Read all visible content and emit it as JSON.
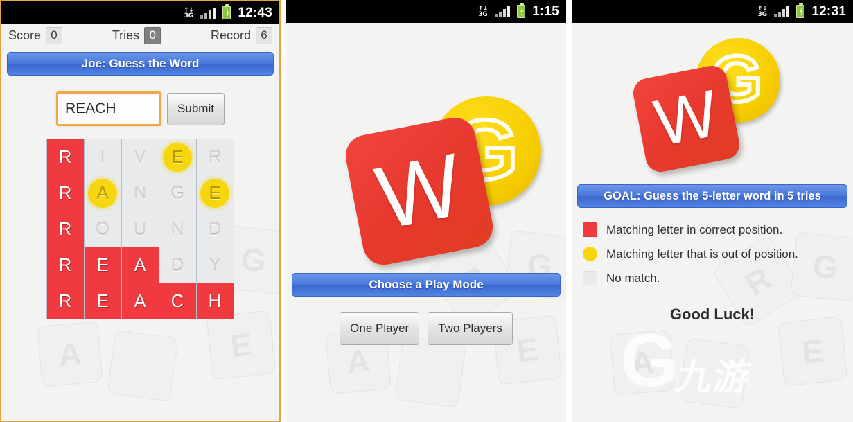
{
  "app": {
    "title": "Joe: Guess the Word",
    "logo_letters": {
      "tile": "W",
      "coin": "G"
    }
  },
  "panels": [
    {
      "status_bar": {
        "network": "3G",
        "time": "12:43",
        "signal_icon": "signal-bars-icon",
        "battery_icon": "battery-icon"
      },
      "scorebar": {
        "score_label": "Score",
        "score_value": "0",
        "tries_label": "Tries",
        "tries_value": "0",
        "record_label": "Record",
        "record_value": "6"
      },
      "banner": "Joe: Guess the Word",
      "input": {
        "value": "REACH",
        "placeholder": ""
      },
      "submit_label": "Submit",
      "grid": [
        {
          "letters": [
            "R",
            "I",
            "V",
            "E",
            "R"
          ],
          "states": [
            "red",
            "none",
            "none",
            "yellow",
            "none"
          ]
        },
        {
          "letters": [
            "R",
            "A",
            "N",
            "G",
            "E"
          ],
          "states": [
            "red",
            "yellow",
            "none",
            "none",
            "yellow"
          ]
        },
        {
          "letters": [
            "R",
            "O",
            "U",
            "N",
            "D"
          ],
          "states": [
            "red",
            "none",
            "none",
            "none",
            "none"
          ]
        },
        {
          "letters": [
            "R",
            "E",
            "A",
            "D",
            "Y"
          ],
          "states": [
            "red",
            "red",
            "red",
            "none",
            "none"
          ]
        },
        {
          "letters": [
            "R",
            "E",
            "A",
            "C",
            "H"
          ],
          "states": [
            "red",
            "red",
            "red",
            "red",
            "red"
          ]
        }
      ]
    },
    {
      "status_bar": {
        "network": "3G",
        "time": "1:15",
        "signal_icon": "signal-bars-icon",
        "battery_icon": "battery-icon"
      },
      "banner": "Choose a Play Mode",
      "modes": [
        "One Player",
        "Two Players"
      ]
    },
    {
      "status_bar": {
        "network": "3G",
        "time": "12:31",
        "signal_icon": "signal-bars-icon",
        "battery_icon": "battery-icon"
      },
      "banner": "GOAL: Guess the 5-letter word in 5 tries",
      "legend": [
        {
          "swatch": "red-square",
          "text": "Matching letter in correct position."
        },
        {
          "swatch": "yellow-circle",
          "text": "Matching letter that is out of position."
        },
        {
          "swatch": "grey-square",
          "text": "No match."
        }
      ],
      "good_luck": "Good Luck!",
      "watermark": {
        "mark": "G",
        "text": "九游"
      }
    }
  ],
  "colors": {
    "red": "#f03a3f",
    "yellow": "#f5d60f",
    "grey": "#e9eaec",
    "banner_blue": "#4a78dc",
    "input_border": "#f0a94a"
  },
  "bg_tiles": [
    "A",
    "R",
    "G",
    "E"
  ]
}
